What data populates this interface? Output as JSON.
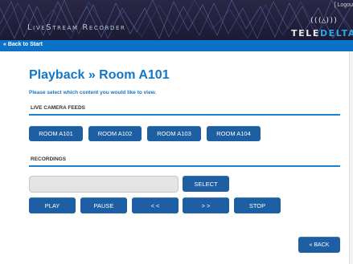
{
  "header": {
    "app_title": "LiveStream Recorder",
    "logout": "[ Logou",
    "brand_signal": "(((△)))",
    "brand_part_a": "TELE",
    "brand_part_b": "DELTA"
  },
  "nav": {
    "back_to_start": "« Back to Start"
  },
  "page": {
    "title": "Playback » Room A101",
    "instruction": "Please select which content you would like to view."
  },
  "live_feeds": {
    "label": "LIVE CAMERA FEEDS",
    "rooms": [
      "ROOM A101",
      "ROOM A102",
      "ROOM A103",
      "ROOM A104"
    ]
  },
  "recordings": {
    "label": "RECORDINGS",
    "select_value": "",
    "select_button": "SELECT",
    "controls": {
      "play": "PLAY",
      "pause": "PAUSE",
      "rewind": "< <",
      "forward": "> >",
      "stop": "STOP"
    }
  },
  "footer": {
    "back": "« BACK"
  },
  "colors": {
    "header_bg": "#1b1a33",
    "nav_bg": "#0b72c7",
    "title_blue": "#1377c8",
    "button_blue": "#1e5fa3",
    "brand_cyan": "#2aa8e8"
  }
}
